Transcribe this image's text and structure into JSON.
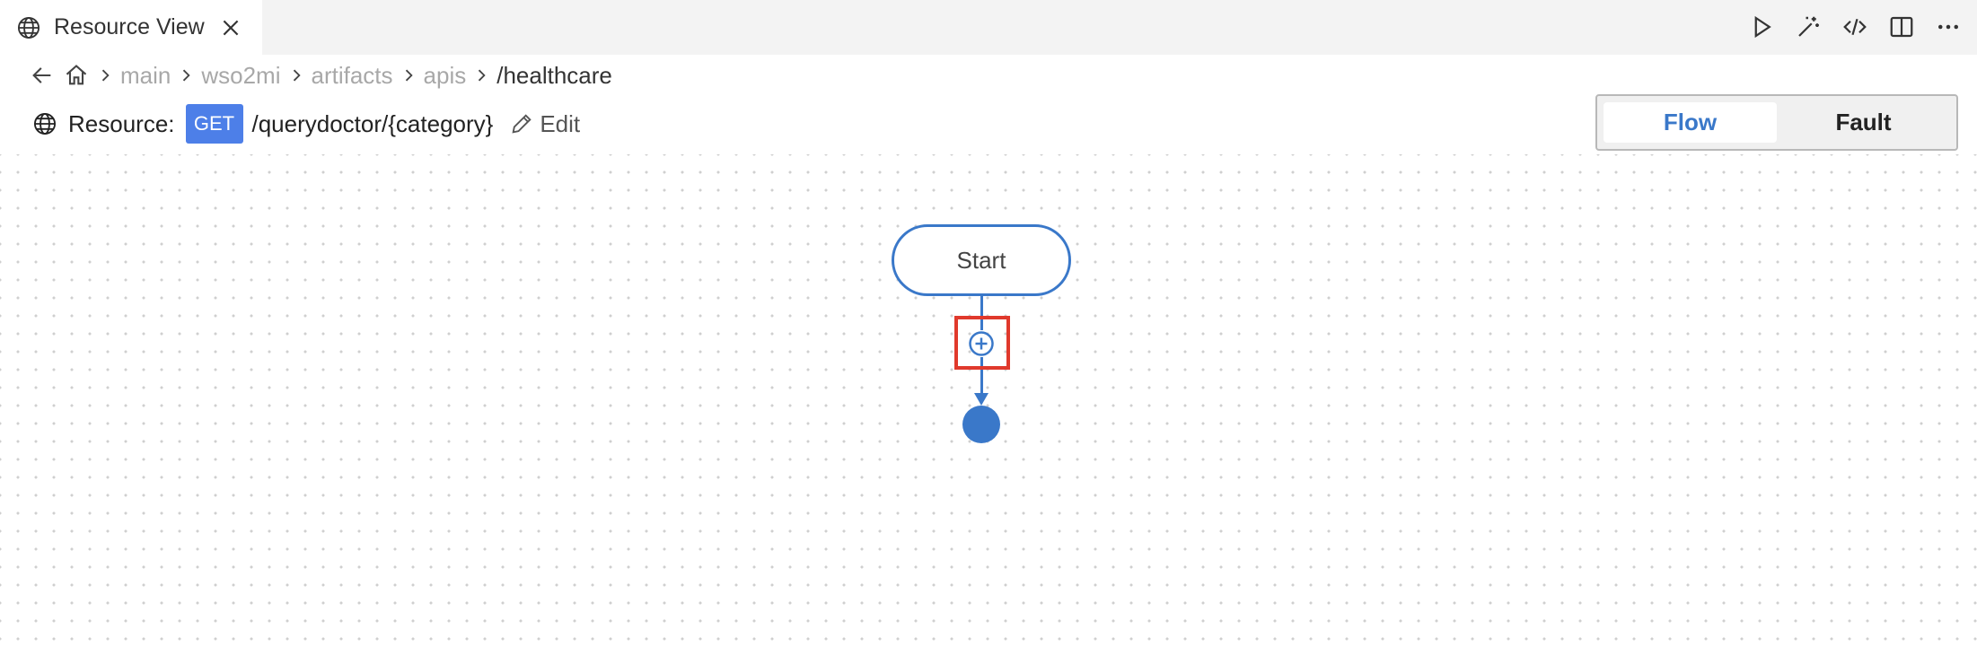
{
  "tab": {
    "title": "Resource View"
  },
  "breadcrumb": {
    "items": [
      "main",
      "wso2mi",
      "artifacts",
      "apis"
    ],
    "current": "/healthcare"
  },
  "resource": {
    "label": "Resource:",
    "method": "GET",
    "path": "/querydoctor/{category}",
    "edit_label": "Edit"
  },
  "view_toggle": {
    "options": [
      "Flow",
      "Fault"
    ],
    "selected": "Flow"
  },
  "diagram": {
    "start_label": "Start"
  },
  "colors": {
    "accent": "#3a78c9",
    "method_badge": "#4d7fe8",
    "highlight": "#e0392c"
  },
  "icons": [
    "globe-icon",
    "close-icon",
    "run-icon",
    "magic-wand-icon",
    "code-icon",
    "split-editor-icon",
    "more-icon",
    "back-arrow-icon",
    "home-icon",
    "chevron-right-icon",
    "pencil-icon",
    "plus-circle-icon"
  ]
}
